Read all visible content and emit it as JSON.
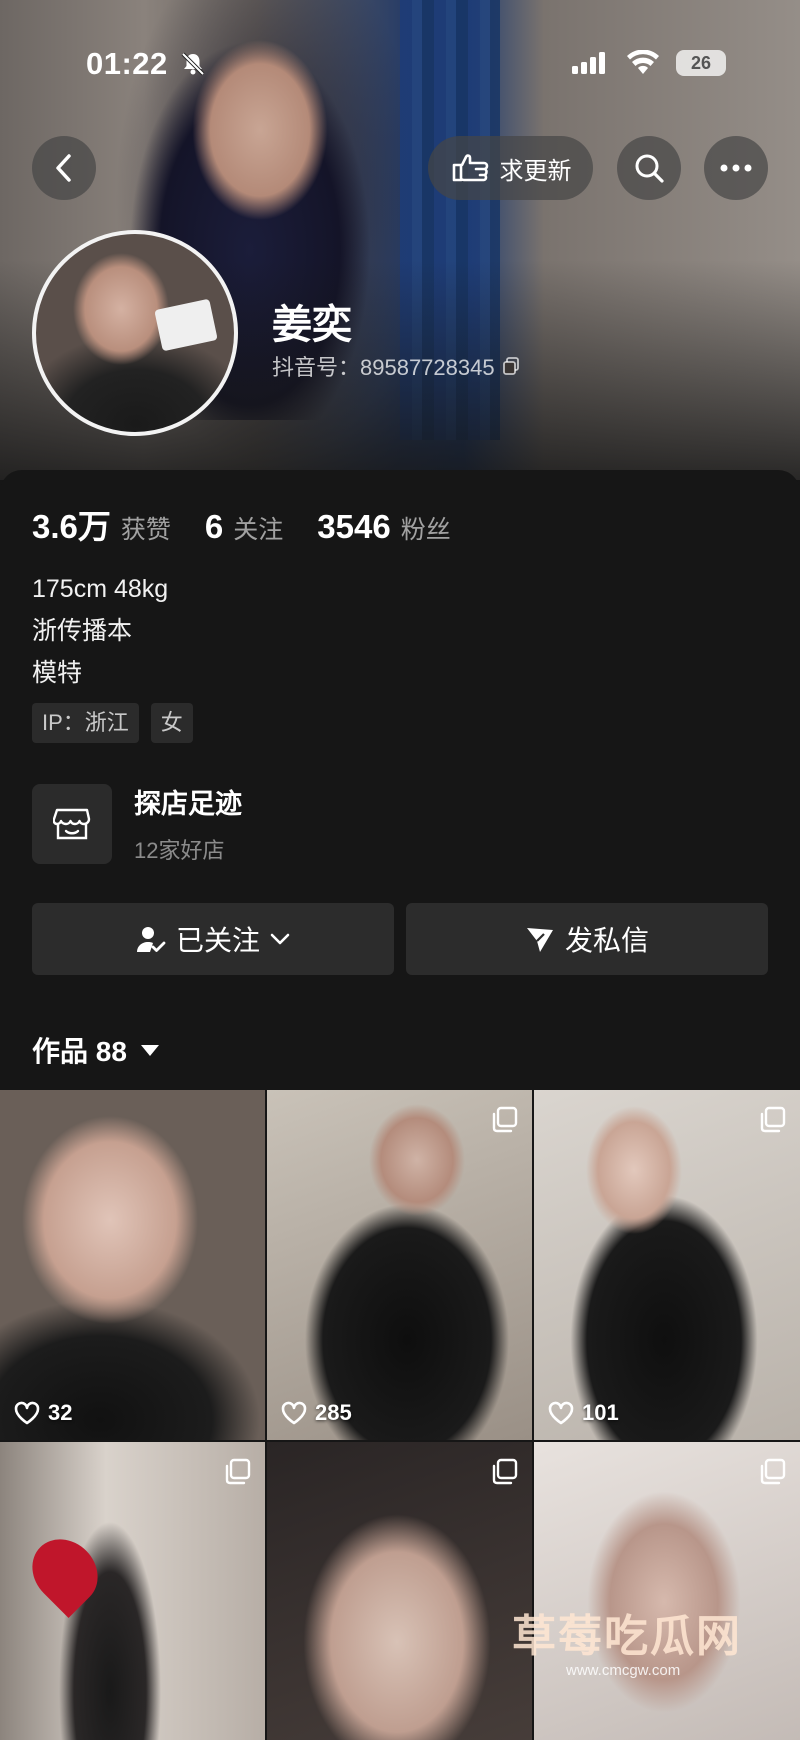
{
  "status_bar": {
    "time": "01:22",
    "battery": "26"
  },
  "nav": {
    "update_label": "求更新"
  },
  "profile": {
    "name": "姜奕",
    "douyin_id": "抖音号：89587728345"
  },
  "stats": [
    {
      "value": "3.6万",
      "label": "获赞"
    },
    {
      "value": "6",
      "label": "关注"
    },
    {
      "value": "3546",
      "label": "粉丝"
    }
  ],
  "bio": [
    "175cm 48kg",
    "浙传播本",
    "模特"
  ],
  "tags": [
    "IP：浙江",
    "女"
  ],
  "shop": {
    "title": "探店足迹",
    "subtitle": "12家好店"
  },
  "actions": {
    "follow_label": "已关注",
    "message_label": "发私信"
  },
  "works": {
    "label": "作品 88"
  },
  "grid": [
    {
      "likes": "32",
      "multi": false
    },
    {
      "likes": "285",
      "multi": true
    },
    {
      "likes": "101",
      "multi": true
    },
    {
      "likes": "",
      "multi": true
    },
    {
      "likes": "",
      "multi": true
    },
    {
      "likes": "",
      "multi": true
    }
  ],
  "watermark": {
    "text": "草莓吃瓜网",
    "url": "www.cmcgw.com"
  },
  "colors": {
    "background": "#161616",
    "button": "#2c2c2c",
    "tag": "#2b2b2b"
  }
}
